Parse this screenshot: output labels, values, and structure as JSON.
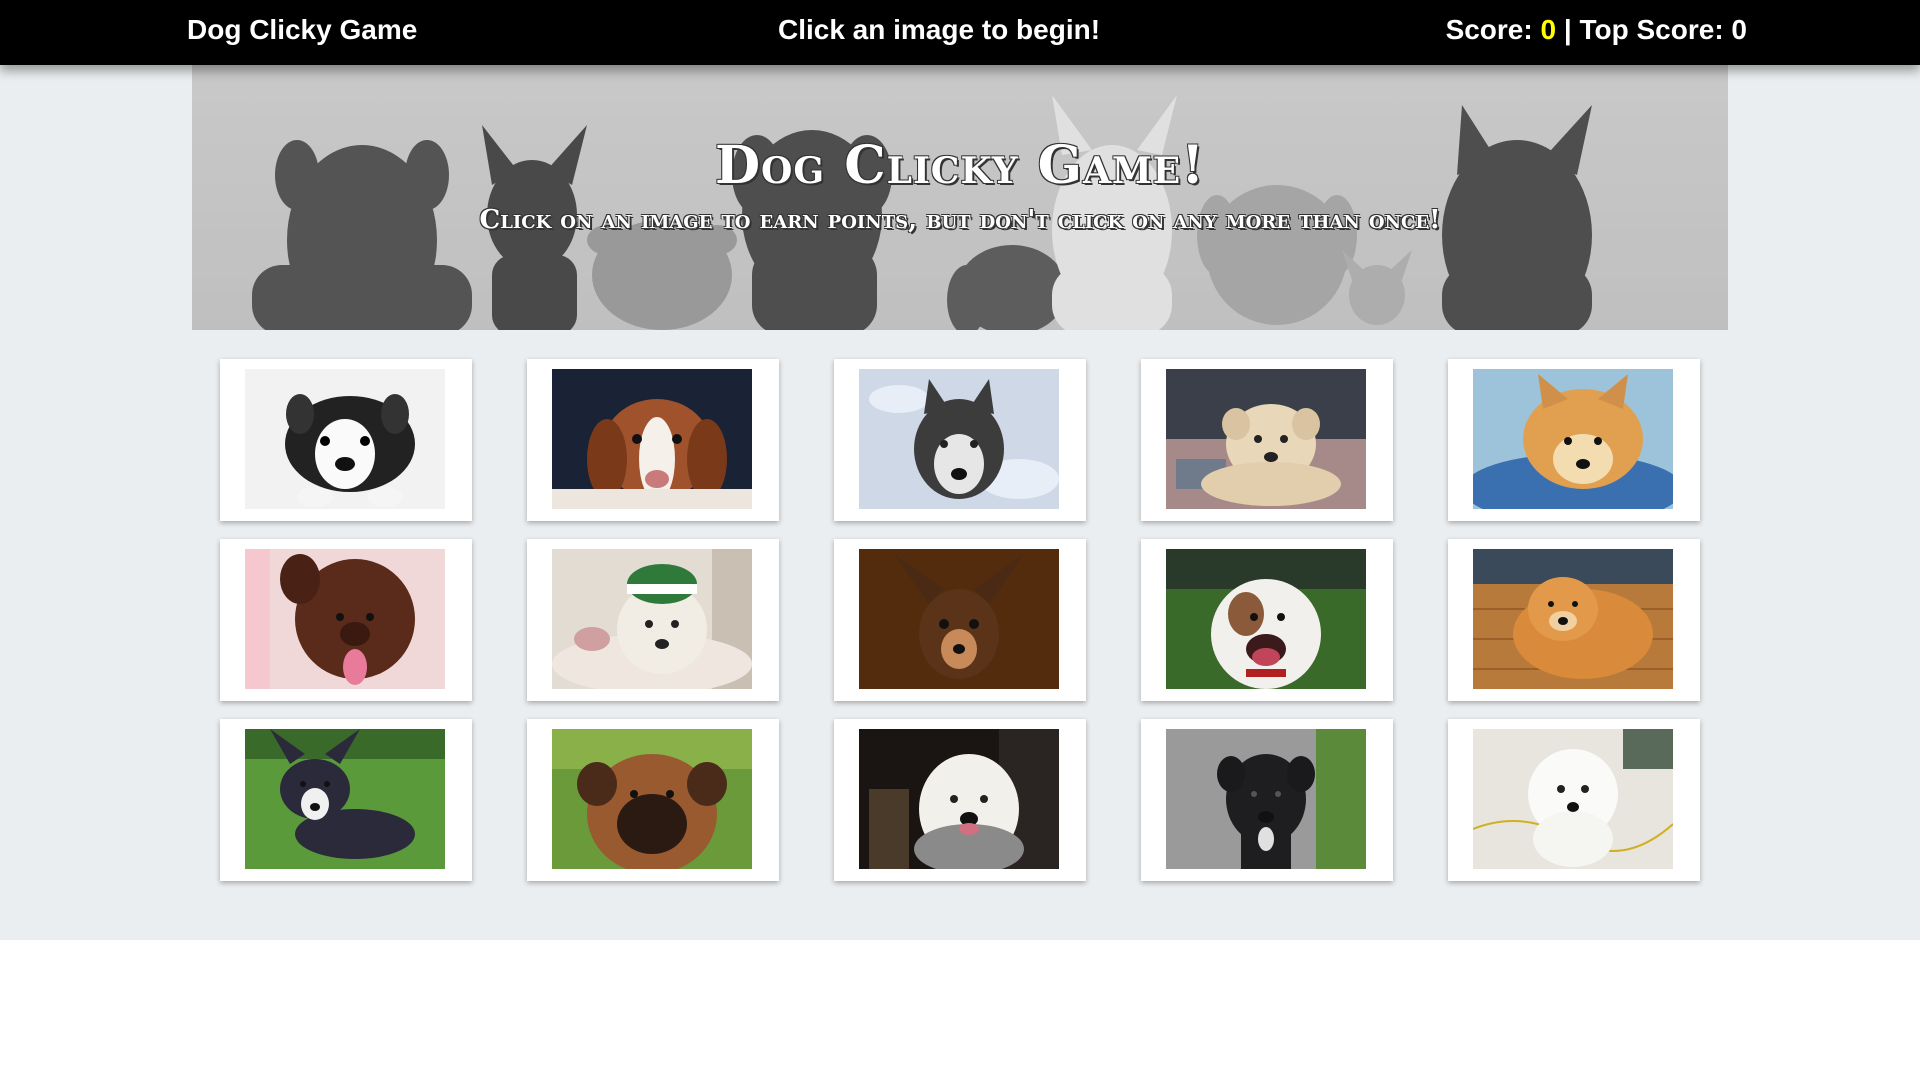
{
  "navbar": {
    "brand": "Dog Clicky Game",
    "message": "Click an image to begin!",
    "score_label": "Score: ",
    "score": "0",
    "separator": " | ",
    "top_score_label": "Top Score: ",
    "top_score": "0"
  },
  "hero": {
    "title": "Dog Clicky Game!",
    "subtitle": "Click on an image to earn points, but don't click on any more than once!"
  },
  "colors": {
    "navbar_bg": "#000000",
    "score_accent": "#ffff00",
    "page_bg": "#ebeef0"
  },
  "cards": [
    {
      "breed": "boston-terrier-puppy"
    },
    {
      "breed": "beagle-puppy"
    },
    {
      "breed": "husky-in-snow"
    },
    {
      "breed": "yorkie-mix-on-bed"
    },
    {
      "breed": "pomeranian-on-pillow"
    },
    {
      "breed": "brown-poodle"
    },
    {
      "breed": "great-pyrenees-in-hat"
    },
    {
      "breed": "chihuahua"
    },
    {
      "breed": "boxer-on-grass"
    },
    {
      "breed": "chow-chow"
    },
    {
      "breed": "corgi-on-grass"
    },
    {
      "breed": "bullmastiff"
    },
    {
      "breed": "old-english-sheepdog"
    },
    {
      "breed": "black-boxer-puppy"
    },
    {
      "breed": "white-maltese"
    }
  ]
}
